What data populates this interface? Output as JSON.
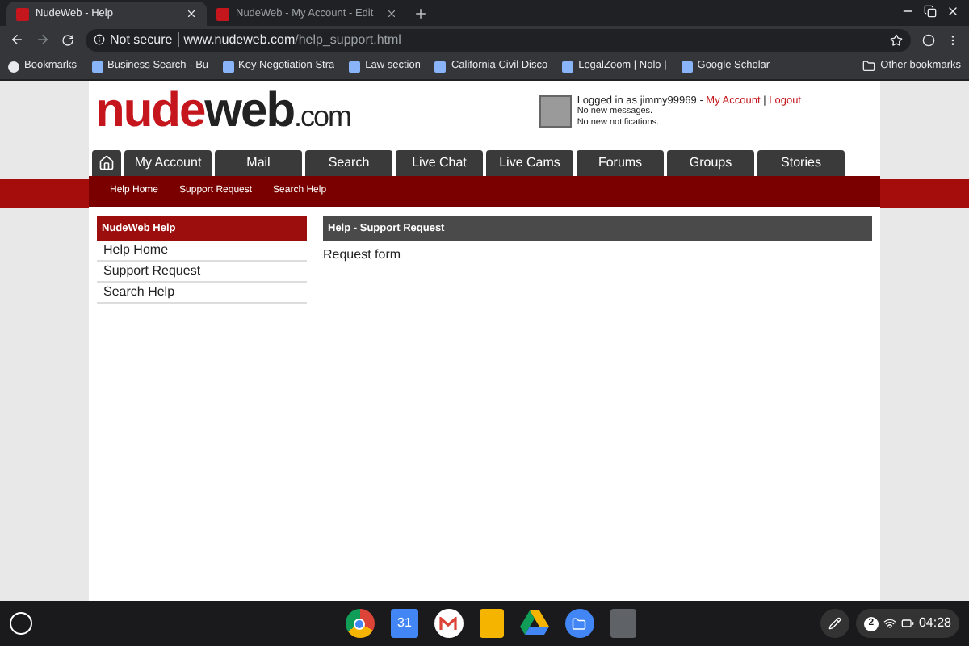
{
  "browser_tabs": [
    {
      "title": "NudeWeb - Help",
      "selected": true
    },
    {
      "title": "NudeWeb - My Account - Edit",
      "selected": false
    }
  ],
  "address_bar": {
    "security": "Not secure",
    "domain": "www.nudeweb.com",
    "path": "/help_support.html"
  },
  "bookmarks": [
    "Bookmarks",
    "Business Search - Bu",
    "Key Negotiation Stra",
    "Law section",
    "California Civil Disco",
    "LegalZoom | Nolo | ",
    "Google Scholar"
  ],
  "other_bookmarks": "Other bookmarks",
  "logo": {
    "brand": "nude",
    "rest": "web",
    "suffix": ".com"
  },
  "user_panel": {
    "logged_in": "Logged in as jimmy99969 - ",
    "links": [
      "My Account",
      "Logout"
    ],
    "separator": "|",
    "messages": "No new messages.",
    "notifications": "No new notifications."
  },
  "nav": [
    {
      "label": "My Account"
    },
    {
      "label": "Mail"
    },
    {
      "label": "Search"
    },
    {
      "label": "Live Chat"
    },
    {
      "label": "Live Cams"
    },
    {
      "label": "Forums"
    },
    {
      "label": "Groups"
    },
    {
      "label": "Stories"
    }
  ],
  "subnav": [
    "Help Home",
    "Support Request",
    "Search Help"
  ],
  "sidebar": {
    "title": "NudeWeb Help",
    "items": [
      "Help Home",
      "Support Request",
      "Search Help"
    ]
  },
  "main": {
    "title": "Help - Support Request",
    "body": "Request form"
  },
  "shelf": {
    "calendar_day": "31",
    "notification_count": "2",
    "time": "04:28"
  }
}
